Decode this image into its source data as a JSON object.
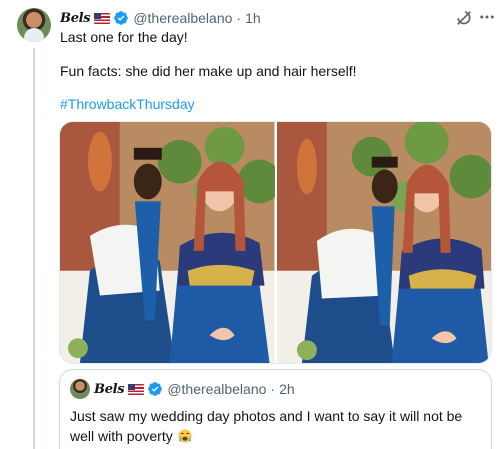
{
  "tweet": {
    "display_name": "Bels",
    "handle": "@therealbelano",
    "separator": "·",
    "time": "1h",
    "lines": [
      "Last one for the day!",
      "Fun facts: she did her make up and hair herself!"
    ],
    "hashtag": "#ThrowbackThursday"
  },
  "quote": {
    "display_name": "Bels",
    "handle": "@therealbelano",
    "separator": "·",
    "time": "2h",
    "text": "Just saw my wedding day photos and I want to say it will not be well with poverty"
  },
  "icons": {
    "verified": "verified-badge-icon",
    "flag": "us-flag-icon",
    "grok": "grok-icon",
    "more": "more-icon",
    "emoji": "crying-face-emoji-icon"
  },
  "colors": {
    "link": "#1d9bf0",
    "secondary_text": "#536471",
    "verified": "#1d9bf0",
    "border": "#cfd9de"
  }
}
